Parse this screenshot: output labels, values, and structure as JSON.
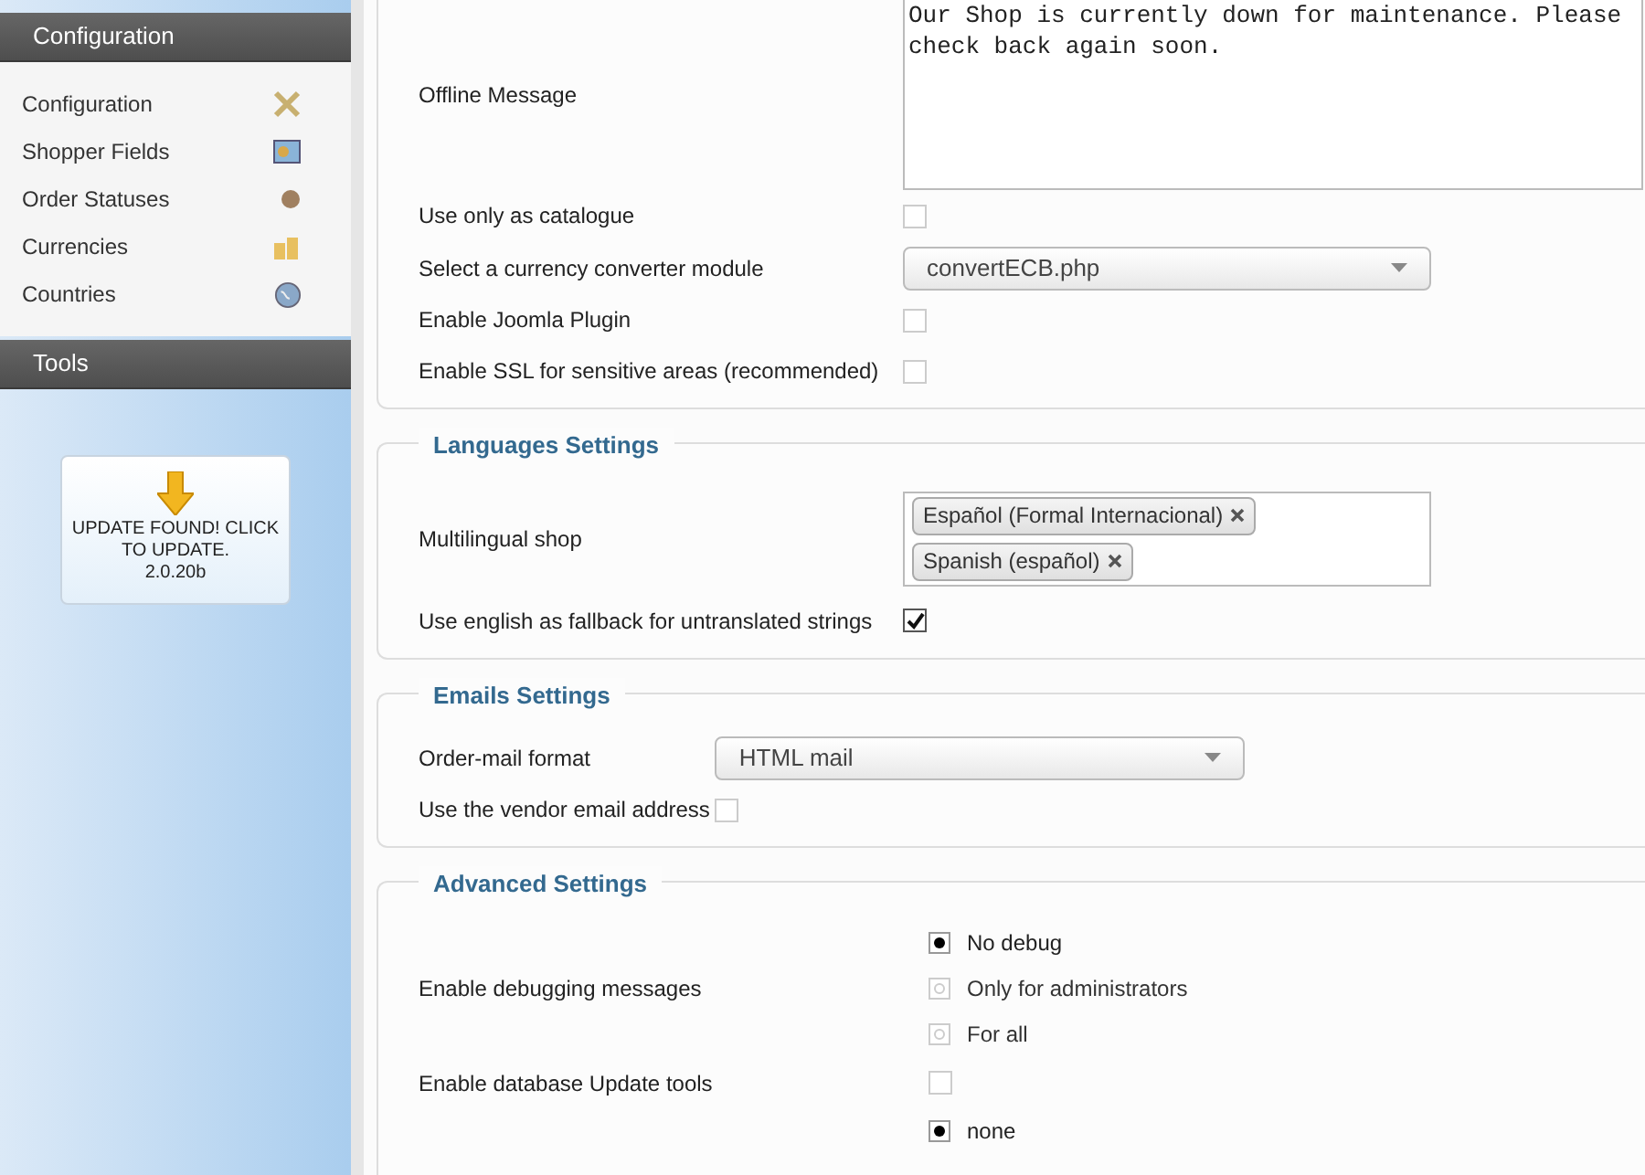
{
  "sidebar": {
    "sections": [
      {
        "title": "Configuration",
        "items": [
          {
            "label": "Configuration"
          },
          {
            "label": "Shopper Fields"
          },
          {
            "label": "Order Statuses"
          },
          {
            "label": "Currencies"
          },
          {
            "label": "Countries"
          }
        ]
      },
      {
        "title": "Tools"
      }
    ],
    "update_notice": {
      "text": "UPDATE FOUND! CLICK TO UPDATE.",
      "version": "2.0.20b"
    }
  },
  "fieldsets": [
    {
      "rows": [
        {
          "kind": "textarea",
          "label": "Offline Message",
          "value": "Our Shop is currently down for maintenance. Please check back again soon."
        },
        {
          "kind": "checkbox",
          "label": "Use only as catalogue",
          "checked": false
        },
        {
          "kind": "select",
          "label": "Select a currency converter module",
          "value": "convertECB.php"
        },
        {
          "kind": "checkbox",
          "label": "Enable Joomla Plugin",
          "checked": false
        },
        {
          "kind": "checkbox",
          "label": "Enable SSL for sensitive areas (recommended)",
          "checked": false
        }
      ]
    },
    {
      "legend": "Languages Settings",
      "rows": [
        {
          "kind": "tags",
          "label": "Multilingual shop",
          "tags": [
            "Español (Formal Internacional)",
            "Spanish (español)"
          ]
        },
        {
          "kind": "checkbox",
          "label": "Use english as fallback for untranslated strings",
          "checked": true
        }
      ]
    },
    {
      "legend": "Emails Settings",
      "rows": [
        {
          "kind": "select",
          "label": "Order-mail format",
          "value": "HTML mail"
        },
        {
          "kind": "checkbox",
          "label": "Use the vendor email address",
          "checked": false
        }
      ]
    },
    {
      "legend": "Advanced Settings",
      "rows": [
        {
          "kind": "radio",
          "label": "Enable debugging messages",
          "options": [
            {
              "label": "No debug",
              "selected": true
            },
            {
              "label": "Only for administrators",
              "selected": false
            },
            {
              "label": "For all",
              "selected": false
            }
          ]
        },
        {
          "kind": "checkbox",
          "label": "Enable database Update tools",
          "checked": false
        },
        {
          "kind": "radio",
          "options": [
            {
              "label": "none",
              "selected": true
            }
          ]
        }
      ]
    }
  ]
}
